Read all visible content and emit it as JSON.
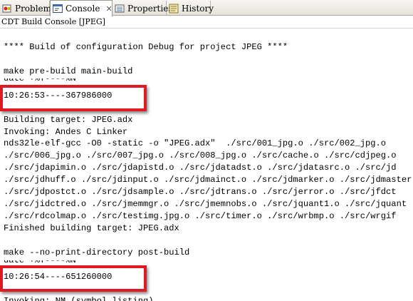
{
  "tabs": [
    {
      "label": "Problems",
      "icon": "problems-icon",
      "active": false
    },
    {
      "label": "Console",
      "icon": "console-icon",
      "active": true,
      "close": "✕"
    },
    {
      "label": "Properties",
      "icon": "properties-icon",
      "active": false
    },
    {
      "label": "History",
      "icon": "history-icon",
      "active": false
    }
  ],
  "console_title": "CDT Build Console [JPEG]",
  "lines": {
    "l01": "**** Build of configuration Debug for project JPEG ****",
    "l02": "make pre-build main-build",
    "l03": "date +%T----%N",
    "l04": "10:26:53----367986000",
    "l05": "Building target: JPEG.adx",
    "l06": "Invoking: Andes C Linker",
    "l07": "nds32le-elf-gcc -O0 -static -o \"JPEG.adx\"  ./src/001_jpg.o ./src/002_jpg.o",
    "l08": "./src/006_jpg.o ./src/007_jpg.o ./src/008_jpg.o ./src/cache.o ./src/cdjpeg.o",
    "l09": "./src/jdapimin.o ./src/jdapistd.o ./src/jdatadst.o ./src/jdatasrc.o ./src/jd",
    "l10": "./src/jdhuff.o ./src/jdinput.o ./src/jdmainct.o ./src/jdmarker.o ./src/jdmaster",
    "l11": "./src/jdpostct.o ./src/jdsample.o ./src/jdtrans.o ./src/jerror.o ./src/jfdct",
    "l12": "./src/jidctred.o ./src/jmemmgr.o ./src/jmemnobs.o ./src/jquant1.o ./src/jquant",
    "l13": "./src/rdcolmap.o ./src/testimg.jpg.o ./src/timer.o ./src/wrbmp.o ./src/wrgif",
    "l14": "Finished building target: JPEG.adx",
    "l15": "make --no-print-directory post-build",
    "l16": "date +%T----%N",
    "l17": "10:26:54----651260000",
    "l18": "Invoking: NM (symbol listing)"
  },
  "colors": {
    "highlight": "#e01a22"
  }
}
